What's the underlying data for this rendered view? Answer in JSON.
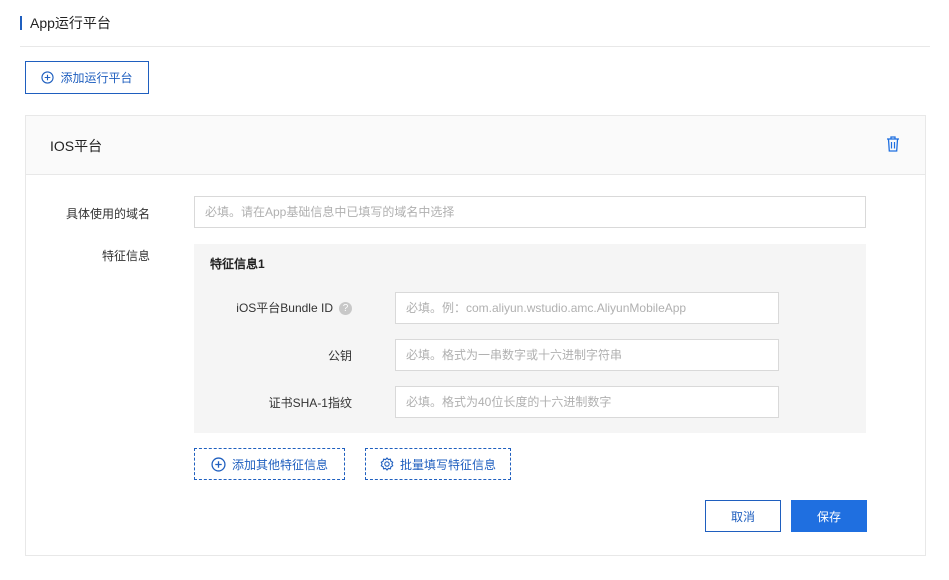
{
  "page": {
    "title": "App运行平台"
  },
  "toolbar": {
    "add_platform_label": "添加运行平台"
  },
  "platform_card": {
    "title": "IOS平台",
    "domain_field": {
      "label": "具体使用的域名",
      "placeholder": "必填。请在App基础信息中已填写的域名中选择",
      "value": ""
    },
    "feature_section_label": "特征信息",
    "feature_group": {
      "title": "特征信息1",
      "fields": [
        {
          "label": "iOS平台Bundle ID",
          "placeholder": "必填。例：com.aliyun.wstudio.amc.AliyunMobileApp",
          "value": "",
          "has_help": true
        },
        {
          "label": "公钥",
          "placeholder": "必填。格式为一串数字或十六进制字符串",
          "value": ""
        },
        {
          "label": "证书SHA-1指纹",
          "placeholder": "必填。格式为40位长度的十六进制数字",
          "value": ""
        }
      ]
    },
    "add_feature_label": "添加其他特征信息",
    "batch_fill_label": "批量填写特征信息",
    "cancel_label": "取消",
    "save_label": "保存"
  },
  "icons": {
    "add_platform": "plus-circle-icon",
    "delete": "trash-icon",
    "help": "question-circle-icon",
    "add_feature": "plus-circle-icon",
    "batch_fill": "gear-icon"
  },
  "colors": {
    "accent": "#1f5fbf",
    "primary_button": "#1f6fe0",
    "panel_bg": "#f5f5f5"
  }
}
